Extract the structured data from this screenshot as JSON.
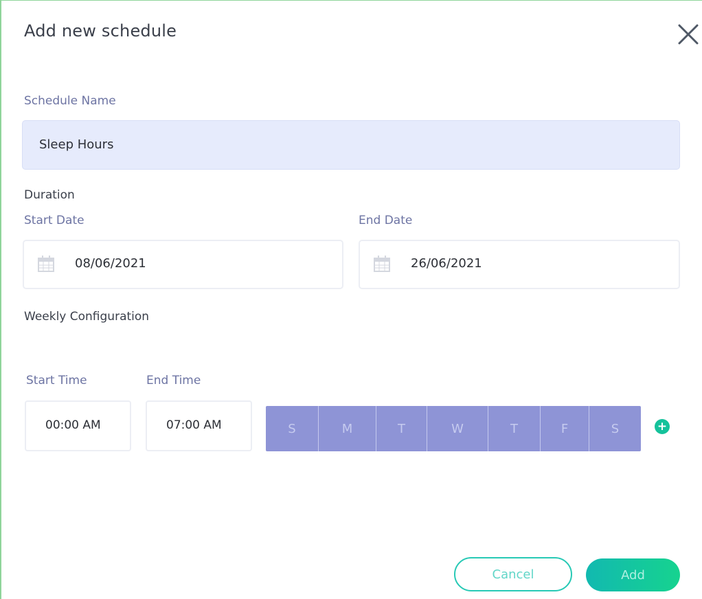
{
  "dialog": {
    "title": "Add new schedule",
    "close_icon": "close-icon"
  },
  "schedule_name": {
    "label": "Schedule Name",
    "value": "Sleep Hours"
  },
  "duration": {
    "label": "Duration",
    "start_date_label": "Start Date",
    "start_date_value": "08/06/2021",
    "end_date_label": "End Date",
    "end_date_value": "26/06/2021",
    "date_icon": "calendar-icon"
  },
  "weekly": {
    "label": "Weekly Configuration",
    "start_time_label": "Start Time",
    "start_time_value": "00:00 AM",
    "end_time_label": "End Time",
    "end_time_value": "07:00 AM",
    "days": [
      "S",
      "M",
      "T",
      "W",
      "T",
      "F",
      "S"
    ],
    "add_icon": "plus-circle-icon"
  },
  "actions": {
    "cancel_label": "Cancel",
    "add_label": "Add"
  },
  "colors": {
    "accent": "#15c29b",
    "day_bar": "#8e94d6",
    "input_fill": "#e6ebfc",
    "label_blue": "#6d74a3"
  }
}
